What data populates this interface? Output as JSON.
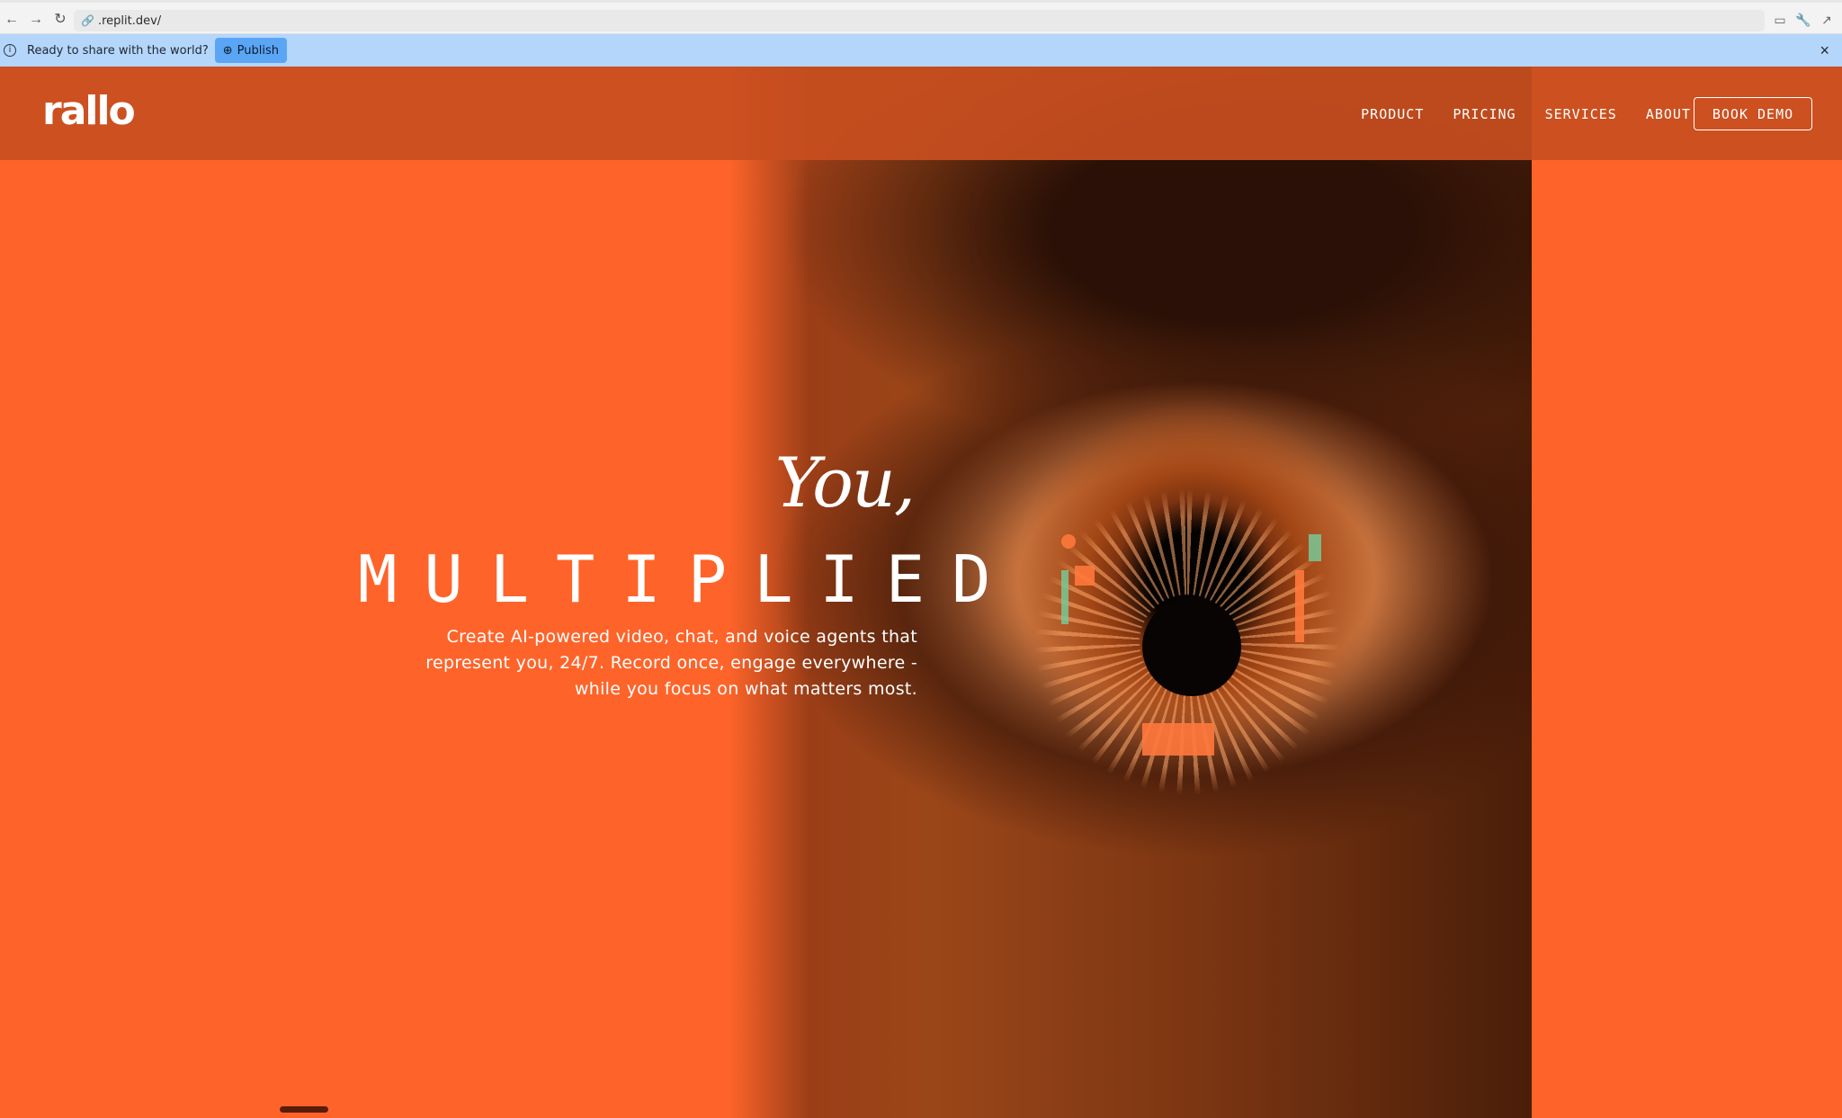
{
  "browser": {
    "back": "←",
    "forward": "→",
    "reload": "↻",
    "url": ".replit.dev/"
  },
  "banner": {
    "message": "Ready to share with the world?",
    "publish_label": "Publish",
    "close": "×"
  },
  "site": {
    "logo": "rallo",
    "nav": [
      "PRODUCT",
      "PRICING",
      "SERVICES",
      "ABOUT"
    ],
    "cta": "BOOK DEMO",
    "hero": {
      "line1": "You,",
      "line2": "MULTIPLIED",
      "subtitle": "Create AI-powered video, chat, and voice agents that represent you, 24/7. Record once, engage everywhere - while you focus on what matters most."
    }
  },
  "colors": {
    "brand_orange": "#fe642a",
    "header": "#c84e20",
    "banner": "#b4d6fb",
    "publish_button": "#5aa6f5"
  }
}
